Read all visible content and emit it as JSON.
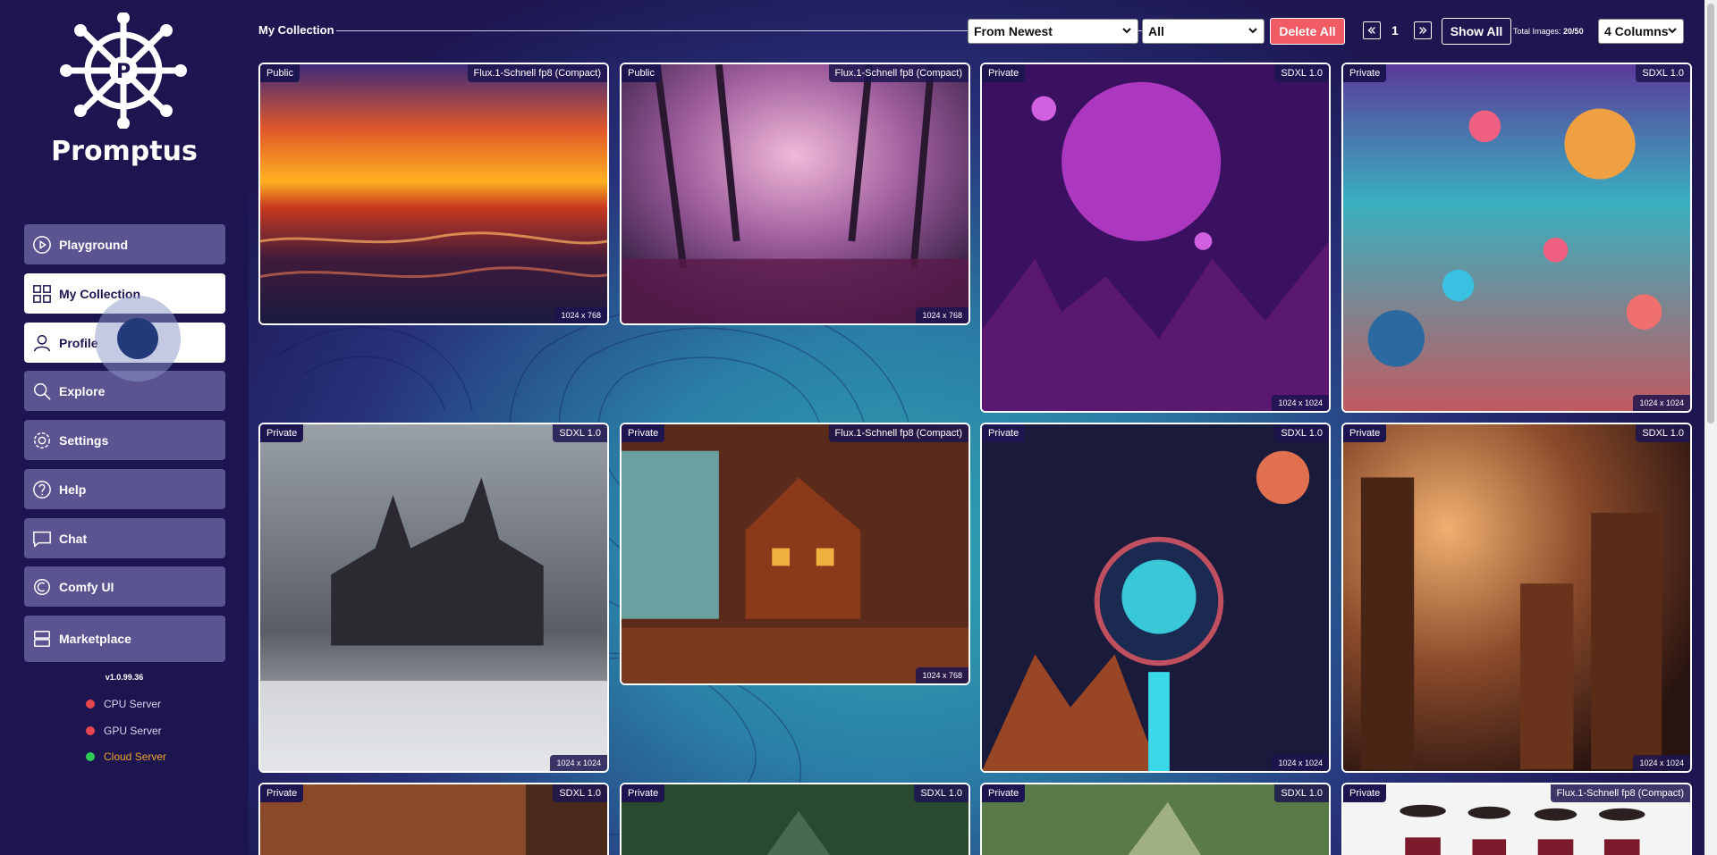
{
  "sidebar": {
    "brand": "Promptus",
    "items": [
      {
        "label": "Playground",
        "icon": "play-circle-icon"
      },
      {
        "label": "My Collection",
        "icon": "grid-icon",
        "active": true
      },
      {
        "label": "Profile",
        "icon": "user-icon",
        "active": true
      },
      {
        "label": "Explore",
        "icon": "search-icon"
      },
      {
        "label": "Settings",
        "icon": "gear-icon"
      },
      {
        "label": "Help",
        "icon": "help-circle-icon"
      },
      {
        "label": "Chat",
        "icon": "chat-icon"
      },
      {
        "label": "Comfy UI",
        "icon": "comfy-icon"
      },
      {
        "label": "Marketplace",
        "icon": "store-icon"
      }
    ],
    "version": "v1.0.99.36",
    "servers": [
      {
        "label": "CPU Server",
        "color": "#e8464f"
      },
      {
        "label": "GPU Server",
        "color": "#e8464f"
      },
      {
        "label": "Cloud Server",
        "color": "#2ecc55"
      }
    ]
  },
  "header": {
    "title": "My Collection",
    "sort_value": "From Newest",
    "filter_value": "All",
    "delete_all": "Delete All",
    "page": "1",
    "show_all": "Show All",
    "total_label": "Total Images:",
    "total_value": "20/50",
    "columns_value": "4 Columns"
  },
  "cards": [
    {
      "visibility": "Public",
      "model": "Flux.1-Schnell fp8 (Compact)",
      "dims": "1024 x 768",
      "art": "sunset-ocean"
    },
    {
      "visibility": "Public",
      "model": "Flux.1-Schnell fp8 (Compact)",
      "dims": "1024 x 768",
      "art": "pink-forest"
    },
    {
      "visibility": "Private",
      "model": "SDXL 1.0",
      "dims": "1024 x 1024",
      "art": "purple-planet"
    },
    {
      "visibility": "Private",
      "model": "SDXL 1.0",
      "dims": "1024 x 1024",
      "art": "orb-landscape"
    },
    {
      "visibility": "Private",
      "model": "SDXL 1.0",
      "dims": "1024 x 1024",
      "art": "haunted-mansion"
    },
    {
      "visibility": "Private",
      "model": "Flux.1-Schnell fp8 (Compact)",
      "dims": "1024 x 768",
      "art": "cozy-house"
    },
    {
      "visibility": "Private",
      "model": "SDXL 1.0",
      "dims": "1024 x 1024",
      "art": "cosmic-portal"
    },
    {
      "visibility": "Private",
      "model": "SDXL 1.0",
      "dims": "1024 x 1024",
      "art": "golden-city"
    },
    {
      "visibility": "Private",
      "model": "SDXL 1.0",
      "dims": "",
      "art": "canyon"
    },
    {
      "visibility": "Private",
      "model": "SDXL 1.0",
      "dims": "",
      "art": "jungle"
    },
    {
      "visibility": "Private",
      "model": "SDXL 1.0",
      "dims": "",
      "art": "jungle-light"
    },
    {
      "visibility": "Private",
      "model": "Flux.1-Schnell fp8 (Compact)",
      "dims": "",
      "art": "cowboys"
    }
  ]
}
